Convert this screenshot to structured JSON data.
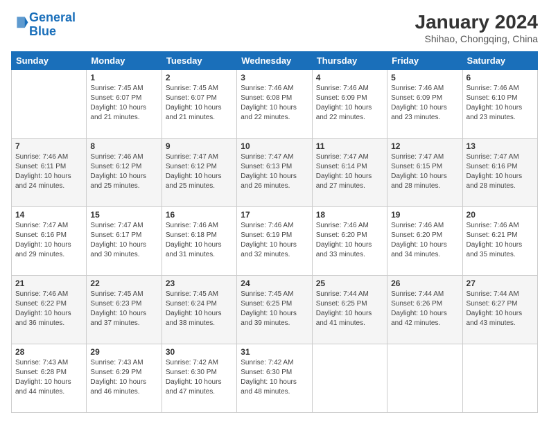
{
  "header": {
    "logo_line1": "General",
    "logo_line2": "Blue",
    "month_year": "January 2024",
    "location": "Shihao, Chongqing, China"
  },
  "days_of_week": [
    "Sunday",
    "Monday",
    "Tuesday",
    "Wednesday",
    "Thursday",
    "Friday",
    "Saturday"
  ],
  "weeks": [
    [
      {
        "num": "",
        "sunrise": "",
        "sunset": "",
        "daylight": "",
        "empty": true
      },
      {
        "num": "1",
        "sunrise": "Sunrise: 7:45 AM",
        "sunset": "Sunset: 6:07 PM",
        "daylight": "Daylight: 10 hours and 21 minutes."
      },
      {
        "num": "2",
        "sunrise": "Sunrise: 7:45 AM",
        "sunset": "Sunset: 6:07 PM",
        "daylight": "Daylight: 10 hours and 21 minutes."
      },
      {
        "num": "3",
        "sunrise": "Sunrise: 7:46 AM",
        "sunset": "Sunset: 6:08 PM",
        "daylight": "Daylight: 10 hours and 22 minutes."
      },
      {
        "num": "4",
        "sunrise": "Sunrise: 7:46 AM",
        "sunset": "Sunset: 6:09 PM",
        "daylight": "Daylight: 10 hours and 22 minutes."
      },
      {
        "num": "5",
        "sunrise": "Sunrise: 7:46 AM",
        "sunset": "Sunset: 6:09 PM",
        "daylight": "Daylight: 10 hours and 23 minutes."
      },
      {
        "num": "6",
        "sunrise": "Sunrise: 7:46 AM",
        "sunset": "Sunset: 6:10 PM",
        "daylight": "Daylight: 10 hours and 23 minutes."
      }
    ],
    [
      {
        "num": "7",
        "sunrise": "Sunrise: 7:46 AM",
        "sunset": "Sunset: 6:11 PM",
        "daylight": "Daylight: 10 hours and 24 minutes."
      },
      {
        "num": "8",
        "sunrise": "Sunrise: 7:46 AM",
        "sunset": "Sunset: 6:12 PM",
        "daylight": "Daylight: 10 hours and 25 minutes."
      },
      {
        "num": "9",
        "sunrise": "Sunrise: 7:47 AM",
        "sunset": "Sunset: 6:12 PM",
        "daylight": "Daylight: 10 hours and 25 minutes."
      },
      {
        "num": "10",
        "sunrise": "Sunrise: 7:47 AM",
        "sunset": "Sunset: 6:13 PM",
        "daylight": "Daylight: 10 hours and 26 minutes."
      },
      {
        "num": "11",
        "sunrise": "Sunrise: 7:47 AM",
        "sunset": "Sunset: 6:14 PM",
        "daylight": "Daylight: 10 hours and 27 minutes."
      },
      {
        "num": "12",
        "sunrise": "Sunrise: 7:47 AM",
        "sunset": "Sunset: 6:15 PM",
        "daylight": "Daylight: 10 hours and 28 minutes."
      },
      {
        "num": "13",
        "sunrise": "Sunrise: 7:47 AM",
        "sunset": "Sunset: 6:16 PM",
        "daylight": "Daylight: 10 hours and 28 minutes."
      }
    ],
    [
      {
        "num": "14",
        "sunrise": "Sunrise: 7:47 AM",
        "sunset": "Sunset: 6:16 PM",
        "daylight": "Daylight: 10 hours and 29 minutes."
      },
      {
        "num": "15",
        "sunrise": "Sunrise: 7:47 AM",
        "sunset": "Sunset: 6:17 PM",
        "daylight": "Daylight: 10 hours and 30 minutes."
      },
      {
        "num": "16",
        "sunrise": "Sunrise: 7:46 AM",
        "sunset": "Sunset: 6:18 PM",
        "daylight": "Daylight: 10 hours and 31 minutes."
      },
      {
        "num": "17",
        "sunrise": "Sunrise: 7:46 AM",
        "sunset": "Sunset: 6:19 PM",
        "daylight": "Daylight: 10 hours and 32 minutes."
      },
      {
        "num": "18",
        "sunrise": "Sunrise: 7:46 AM",
        "sunset": "Sunset: 6:20 PM",
        "daylight": "Daylight: 10 hours and 33 minutes."
      },
      {
        "num": "19",
        "sunrise": "Sunrise: 7:46 AM",
        "sunset": "Sunset: 6:20 PM",
        "daylight": "Daylight: 10 hours and 34 minutes."
      },
      {
        "num": "20",
        "sunrise": "Sunrise: 7:46 AM",
        "sunset": "Sunset: 6:21 PM",
        "daylight": "Daylight: 10 hours and 35 minutes."
      }
    ],
    [
      {
        "num": "21",
        "sunrise": "Sunrise: 7:46 AM",
        "sunset": "Sunset: 6:22 PM",
        "daylight": "Daylight: 10 hours and 36 minutes."
      },
      {
        "num": "22",
        "sunrise": "Sunrise: 7:45 AM",
        "sunset": "Sunset: 6:23 PM",
        "daylight": "Daylight: 10 hours and 37 minutes."
      },
      {
        "num": "23",
        "sunrise": "Sunrise: 7:45 AM",
        "sunset": "Sunset: 6:24 PM",
        "daylight": "Daylight: 10 hours and 38 minutes."
      },
      {
        "num": "24",
        "sunrise": "Sunrise: 7:45 AM",
        "sunset": "Sunset: 6:25 PM",
        "daylight": "Daylight: 10 hours and 39 minutes."
      },
      {
        "num": "25",
        "sunrise": "Sunrise: 7:44 AM",
        "sunset": "Sunset: 6:25 PM",
        "daylight": "Daylight: 10 hours and 41 minutes."
      },
      {
        "num": "26",
        "sunrise": "Sunrise: 7:44 AM",
        "sunset": "Sunset: 6:26 PM",
        "daylight": "Daylight: 10 hours and 42 minutes."
      },
      {
        "num": "27",
        "sunrise": "Sunrise: 7:44 AM",
        "sunset": "Sunset: 6:27 PM",
        "daylight": "Daylight: 10 hours and 43 minutes."
      }
    ],
    [
      {
        "num": "28",
        "sunrise": "Sunrise: 7:43 AM",
        "sunset": "Sunset: 6:28 PM",
        "daylight": "Daylight: 10 hours and 44 minutes."
      },
      {
        "num": "29",
        "sunrise": "Sunrise: 7:43 AM",
        "sunset": "Sunset: 6:29 PM",
        "daylight": "Daylight: 10 hours and 46 minutes."
      },
      {
        "num": "30",
        "sunrise": "Sunrise: 7:42 AM",
        "sunset": "Sunset: 6:30 PM",
        "daylight": "Daylight: 10 hours and 47 minutes."
      },
      {
        "num": "31",
        "sunrise": "Sunrise: 7:42 AM",
        "sunset": "Sunset: 6:30 PM",
        "daylight": "Daylight: 10 hours and 48 minutes."
      },
      {
        "num": "",
        "sunrise": "",
        "sunset": "",
        "daylight": "",
        "empty": true
      },
      {
        "num": "",
        "sunrise": "",
        "sunset": "",
        "daylight": "",
        "empty": true
      },
      {
        "num": "",
        "sunrise": "",
        "sunset": "",
        "daylight": "",
        "empty": true
      }
    ]
  ]
}
